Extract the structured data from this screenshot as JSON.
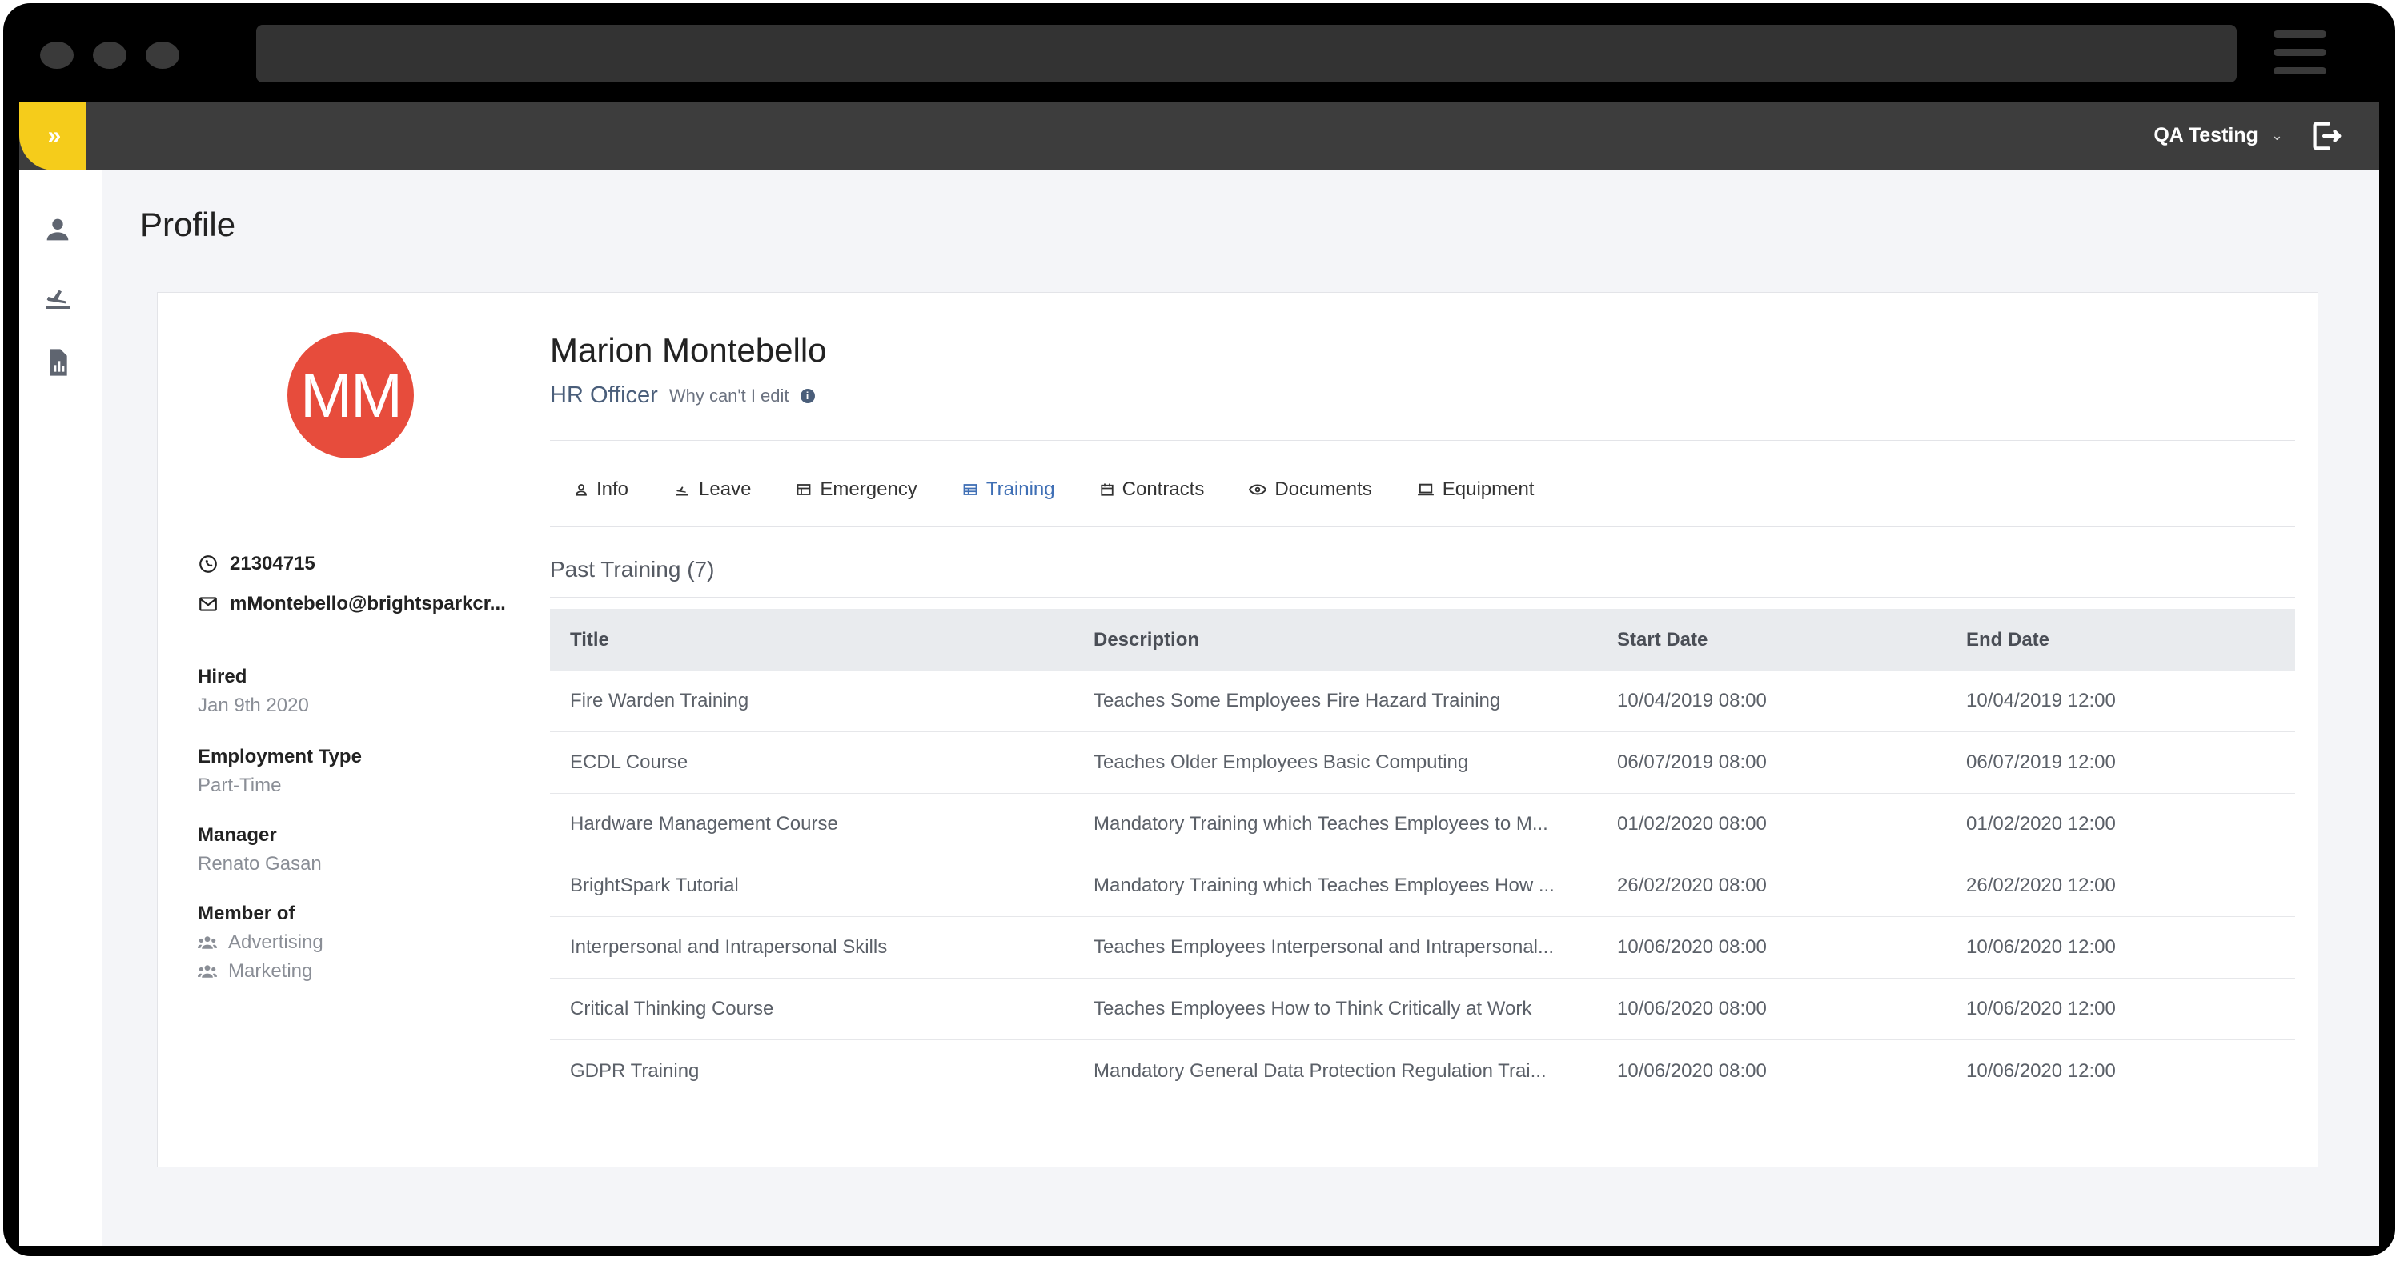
{
  "header": {
    "user_name": "QA Testing",
    "toggle_label": "»"
  },
  "page": {
    "title": "Profile"
  },
  "profile": {
    "initials": "MM",
    "avatar_color": "#e74c3c",
    "name": "Marion Montebello",
    "role": "HR Officer",
    "why_edit": "Why can't I edit",
    "phone": "21304715",
    "email": "mMontebello@brightsparkcr...",
    "hired_label": "Hired",
    "hired_value": "Jan 9th 2020",
    "employment_label": "Employment Type",
    "employment_value": "Part-Time",
    "manager_label": "Manager",
    "manager_value": "Renato Gasan",
    "member_label": "Member of",
    "groups": [
      "Advertising",
      "Marketing"
    ]
  },
  "tabs": [
    {
      "label": "Info",
      "icon": "person-icon",
      "active": false
    },
    {
      "label": "Leave",
      "icon": "plane-icon",
      "active": false
    },
    {
      "label": "Emergency",
      "icon": "card-icon",
      "active": false
    },
    {
      "label": "Training",
      "icon": "table-icon",
      "active": true
    },
    {
      "label": "Contracts",
      "icon": "calendar-icon",
      "active": false
    },
    {
      "label": "Documents",
      "icon": "eye-icon",
      "active": false
    },
    {
      "label": "Equipment",
      "icon": "laptop-icon",
      "active": false
    }
  ],
  "training": {
    "section_title": "Past Training (7)",
    "columns": [
      "Title",
      "Description",
      "Start Date",
      "End Date"
    ],
    "rows": [
      [
        "Fire Warden Training",
        "Teaches Some Employees Fire Hazard Training",
        "10/04/2019 08:00",
        "10/04/2019 12:00"
      ],
      [
        "ECDL Course",
        "Teaches Older Employees Basic Computing",
        "06/07/2019 08:00",
        "06/07/2019 12:00"
      ],
      [
        "Hardware Management Course",
        "Mandatory Training which Teaches Employees to M...",
        "01/02/2020 08:00",
        "01/02/2020 12:00"
      ],
      [
        "BrightSpark Tutorial",
        "Mandatory Training which Teaches Employees How ...",
        "26/02/2020 08:00",
        "26/02/2020 12:00"
      ],
      [
        "Interpersonal and Intrapersonal Skills",
        "Teaches Employees Interpersonal and Intrapersonal...",
        "10/06/2020 08:00",
        "10/06/2020 12:00"
      ],
      [
        "Critical Thinking Course",
        "Teaches Employees How to Think Critically at Work",
        "10/06/2020 08:00",
        "10/06/2020 12:00"
      ],
      [
        "GDPR Training",
        "Mandatory General Data Protection Regulation Trai...",
        "10/06/2020 08:00",
        "10/06/2020 12:00"
      ]
    ]
  },
  "colors": {
    "accent": "#f5cc1b",
    "active_tab": "#3f6fb5",
    "topbar": "#3d3d3d"
  }
}
